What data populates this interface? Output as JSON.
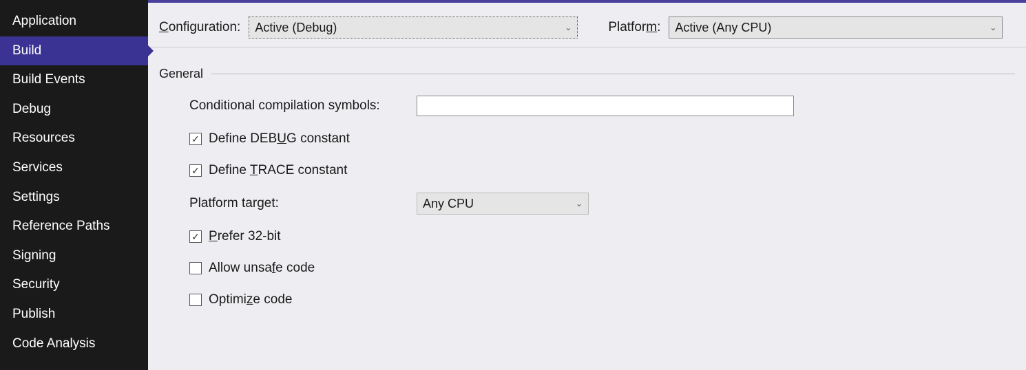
{
  "sidebar": {
    "items": [
      {
        "label": "Application",
        "selected": false
      },
      {
        "label": "Build",
        "selected": true
      },
      {
        "label": "Build Events",
        "selected": false
      },
      {
        "label": "Debug",
        "selected": false
      },
      {
        "label": "Resources",
        "selected": false
      },
      {
        "label": "Services",
        "selected": false
      },
      {
        "label": "Settings",
        "selected": false
      },
      {
        "label": "Reference Paths",
        "selected": false
      },
      {
        "label": "Signing",
        "selected": false
      },
      {
        "label": "Security",
        "selected": false
      },
      {
        "label": "Publish",
        "selected": false
      },
      {
        "label": "Code Analysis",
        "selected": false
      }
    ]
  },
  "top": {
    "configuration_label_pre": "C",
    "configuration_label_post": "onfiguration:",
    "configuration_value": "Active (Debug)",
    "platform_label_pre": "Platfor",
    "platform_label_post": ":",
    "platform_label_u": "m",
    "platform_value": "Active (Any CPU)"
  },
  "section": {
    "general": "General"
  },
  "form": {
    "cond_symbols_label": "Conditional compilation symbols:",
    "cond_symbols_value": "",
    "define_debug_pre": "Define DEB",
    "define_debug_u": "U",
    "define_debug_post": "G constant",
    "define_debug_checked": true,
    "define_trace_pre": "Define ",
    "define_trace_u": "T",
    "define_trace_post": "RACE constant",
    "define_trace_checked": true,
    "platform_target_label_pre": "Platform tar",
    "platform_target_label_u": "g",
    "platform_target_label_post": "et:",
    "platform_target_value": "Any CPU",
    "prefer32_u": "P",
    "prefer32_post": "refer 32-bit",
    "prefer32_checked": true,
    "unsafe_pre": "Allow unsa",
    "unsafe_u": "f",
    "unsafe_post": "e code",
    "unsafe_checked": false,
    "optimize_pre": "Optimi",
    "optimize_u": "z",
    "optimize_post": "e code",
    "optimize_checked": false
  }
}
